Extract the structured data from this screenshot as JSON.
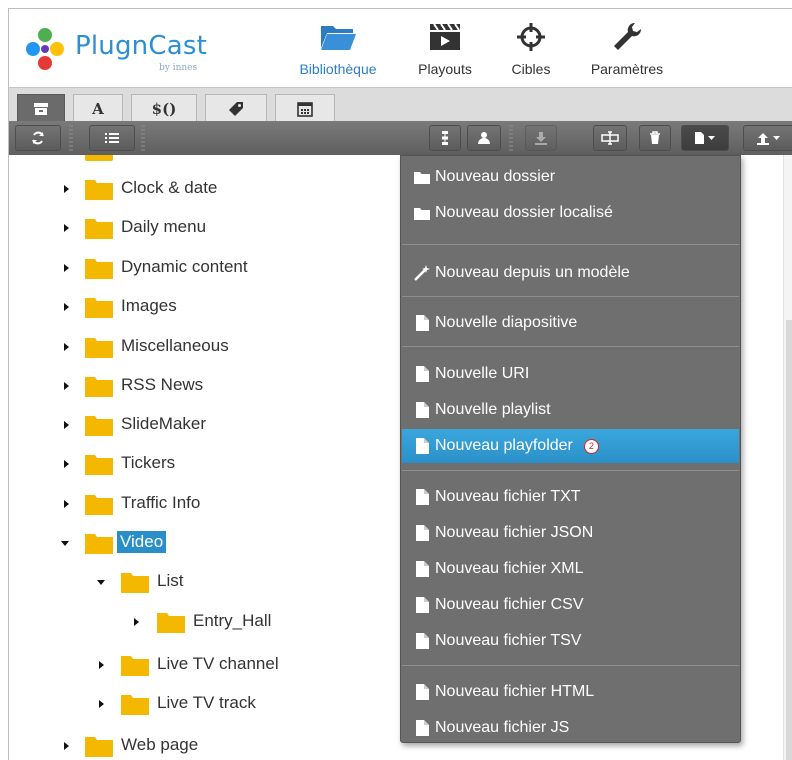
{
  "app": {
    "name": "PlugnCast",
    "subtitle": "by innes"
  },
  "nav": [
    {
      "label": "Bibliothèque",
      "icon": "folder-open-icon",
      "active": true
    },
    {
      "label": "Playouts",
      "icon": "film-clapper-icon",
      "active": false
    },
    {
      "label": "Cibles",
      "icon": "target-icon",
      "active": false
    },
    {
      "label": "Paramètres",
      "icon": "wrench-icon",
      "active": false
    }
  ],
  "tabs": [
    {
      "label": "",
      "icon": "archive-box-icon",
      "active": true
    },
    {
      "label": "A",
      "icon": "font-icon",
      "active": false
    },
    {
      "label": "$()",
      "icon": "variable-icon",
      "active": false
    },
    {
      "label": "",
      "icon": "tag-icon",
      "active": false
    },
    {
      "label": "",
      "icon": "calendar-icon",
      "active": false
    }
  ],
  "toolbar": {
    "left": [
      "refresh-icon",
      "list-icon"
    ],
    "right": [
      "tree-structure-icon",
      "user-icon",
      "download-icon",
      "rename-icon",
      "trash-icon",
      "new-file-dropdown-icon",
      "upload-dropdown-icon"
    ]
  },
  "tree": {
    "items": [
      {
        "label": "Clock & date",
        "state": "collapsed"
      },
      {
        "label": "Daily menu",
        "state": "collapsed"
      },
      {
        "label": "Dynamic content",
        "state": "collapsed"
      },
      {
        "label": "Images",
        "state": "collapsed"
      },
      {
        "label": "Miscellaneous",
        "state": "collapsed"
      },
      {
        "label": "RSS News",
        "state": "collapsed"
      },
      {
        "label": "SlideMaker",
        "state": "collapsed"
      },
      {
        "label": "Tickers",
        "state": "collapsed"
      },
      {
        "label": "Traffic Info",
        "state": "collapsed"
      },
      {
        "label": "Video",
        "state": "expanded",
        "selected": true
      },
      {
        "label": "List",
        "state": "expanded"
      },
      {
        "label": "Entry_Hall",
        "state": "collapsed"
      },
      {
        "label": "Live TV channel",
        "state": "collapsed"
      },
      {
        "label": "Live TV track",
        "state": "collapsed"
      },
      {
        "label": "Web page",
        "state": "collapsed"
      }
    ]
  },
  "menu": {
    "items": [
      {
        "label": "Nouveau dossier",
        "icon": "folder-icon"
      },
      {
        "label": "Nouveau dossier localisé",
        "icon": "folder-icon"
      },
      {
        "label": "Nouveau depuis un modèle",
        "icon": "magic-wand-icon"
      },
      {
        "label": "Nouvelle diapositive",
        "icon": "file-icon"
      },
      {
        "label": "Nouvelle URI",
        "icon": "file-icon"
      },
      {
        "label": "Nouvelle playlist",
        "icon": "file-icon"
      },
      {
        "label": "Nouveau playfolder",
        "icon": "file-icon",
        "highlighted": true,
        "badge": "2"
      },
      {
        "label": "Nouveau fichier TXT",
        "icon": "file-icon"
      },
      {
        "label": "Nouveau fichier JSON",
        "icon": "file-icon"
      },
      {
        "label": "Nouveau fichier XML",
        "icon": "file-icon"
      },
      {
        "label": "Nouveau fichier CSV",
        "icon": "file-icon"
      },
      {
        "label": "Nouveau fichier TSV",
        "icon": "file-icon"
      },
      {
        "label": "Nouveau fichier HTML",
        "icon": "file-icon"
      },
      {
        "label": "Nouveau fichier JS",
        "icon": "file-icon"
      }
    ]
  },
  "colors": {
    "accent": "#2a8fc8",
    "folder": "#f5b800",
    "menu_bg": "#6f6f6f",
    "toolbar_bg": "#666666"
  }
}
